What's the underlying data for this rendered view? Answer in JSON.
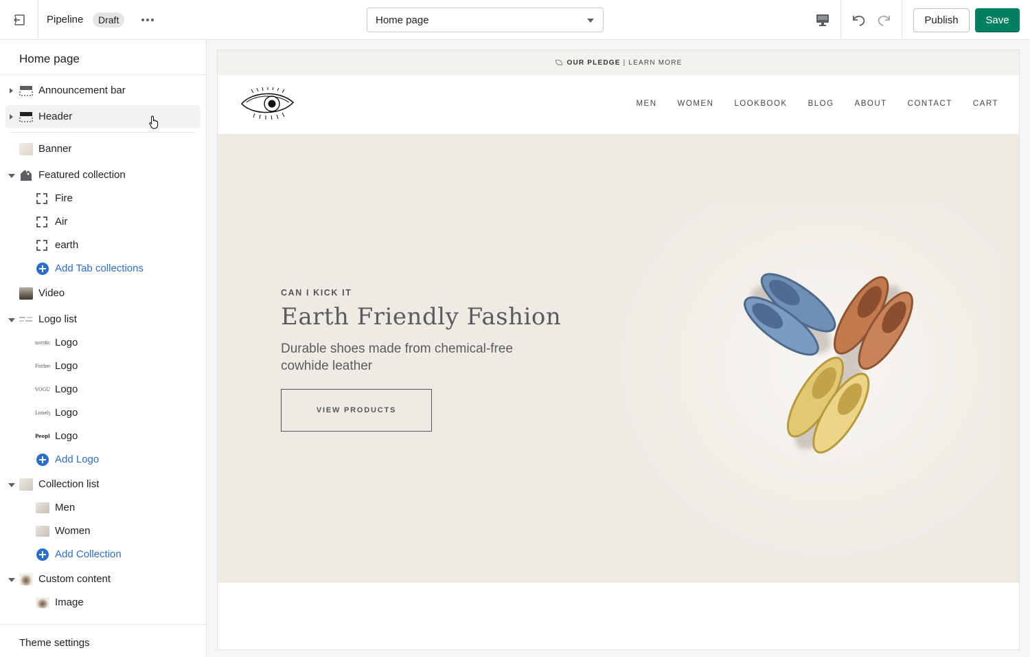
{
  "topbar": {
    "theme_name": "Pipeline",
    "status_badge": "Draft",
    "page_select_value": "Home page",
    "publish_label": "Publish",
    "save_label": "Save",
    "accent_color": "#008060"
  },
  "sidebar": {
    "title": "Home page",
    "sections": [
      {
        "label": "Announcement bar"
      },
      {
        "label": "Header"
      },
      {
        "label": "Banner"
      },
      {
        "label": "Featured collection"
      },
      {
        "label": "Fire"
      },
      {
        "label": "Air"
      },
      {
        "label": "earth"
      },
      {
        "label": "Add Tab collections"
      },
      {
        "label": "Video"
      },
      {
        "label": "Logo list"
      },
      {
        "label": "Logo"
      },
      {
        "label": "Logo"
      },
      {
        "label": "Logo"
      },
      {
        "label": "Logo"
      },
      {
        "label": "Logo"
      },
      {
        "label": "Add Logo"
      },
      {
        "label": "Collection list"
      },
      {
        "label": "Men"
      },
      {
        "label": "Women"
      },
      {
        "label": "Add Collection"
      },
      {
        "label": "Custom content"
      },
      {
        "label": "Image"
      }
    ],
    "logo_thumb_texts": [
      "nordic style",
      "Forbes",
      "VOGUE",
      "Lonely plan",
      "People"
    ],
    "theme_settings_label": "Theme settings"
  },
  "preview": {
    "announcement": {
      "bold": "OUR PLEDGE",
      "divider": "|",
      "link": "LEARN MORE"
    },
    "nav": [
      "MEN",
      "WOMEN",
      "LOOKBOOK",
      "BLOG",
      "ABOUT",
      "CONTACT",
      "CART"
    ],
    "hero": {
      "kicker": "CAN I KICK IT",
      "title": "Earth Friendly Fashion",
      "subtitle": "Durable shoes made from chemical-free cowhide leather",
      "button": "VIEW PRODUCTS"
    }
  }
}
